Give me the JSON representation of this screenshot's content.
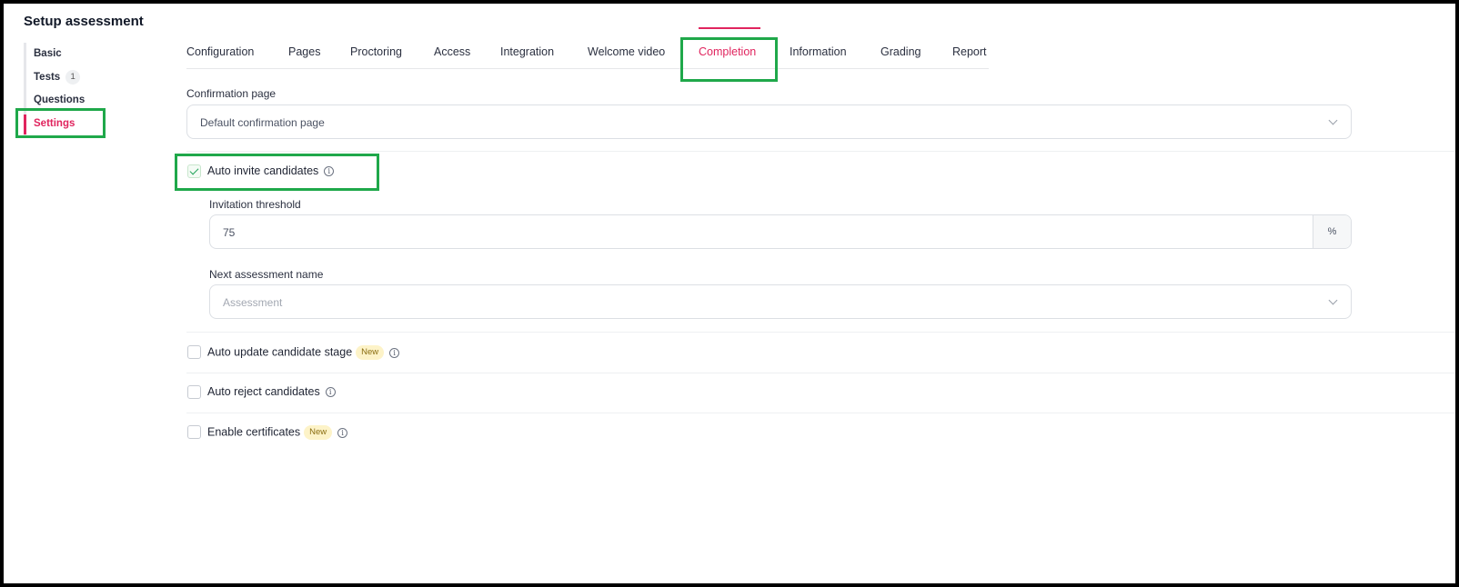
{
  "page_title": "Setup assessment",
  "left_nav": {
    "items": [
      {
        "label": "Basic"
      },
      {
        "label": "Tests",
        "count": "1"
      },
      {
        "label": "Questions"
      },
      {
        "label": "Settings",
        "active": true
      }
    ]
  },
  "tabs": [
    {
      "label": "Configuration"
    },
    {
      "label": "Pages"
    },
    {
      "label": "Proctoring"
    },
    {
      "label": "Access"
    },
    {
      "label": "Integration"
    },
    {
      "label": "Welcome video"
    },
    {
      "label": "Completion",
      "active": true
    },
    {
      "label": "Information"
    },
    {
      "label": "Grading"
    },
    {
      "label": "Report"
    }
  ],
  "form": {
    "confirmation_label": "Confirmation page",
    "confirmation_value": "Default confirmation page",
    "auto_invite": {
      "label": "Auto invite candidates",
      "checked": true
    },
    "threshold_label": "Invitation threshold",
    "threshold_value": "75",
    "threshold_suffix": "%",
    "next_assessment_label": "Next assessment name",
    "next_assessment_placeholder": "Assessment",
    "auto_update": {
      "label": "Auto update candidate stage",
      "badge": "New",
      "checked": false
    },
    "auto_reject": {
      "label": "Auto reject candidates",
      "checked": false
    },
    "certificates": {
      "label": "Enable certificates",
      "badge": "New",
      "checked": false
    }
  },
  "info_glyph": "i",
  "colors": {
    "accent": "#e0245e",
    "highlight": "#1fa84a",
    "check": "#22a35a"
  }
}
